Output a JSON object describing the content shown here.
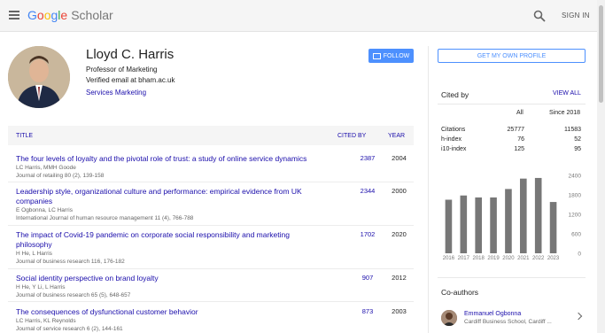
{
  "header": {
    "logo_google": [
      "G",
      "o",
      "o",
      "g",
      "l",
      "e"
    ],
    "logo_scholar": "Scholar",
    "signin": "SIGN IN"
  },
  "profile": {
    "name": "Lloyd C. Harris",
    "affiliation": "Professor of Marketing",
    "email": "Verified email at bham.ac.uk",
    "interest": "Services Marketing",
    "follow": "FOLLOW"
  },
  "table": {
    "col_title": "TITLE",
    "col_cited": "CITED BY",
    "col_year": "YEAR",
    "rows": [
      {
        "title": "The four levels of loyalty and the pivotal role of trust: a study of online service dynamics",
        "authors": "LC Harris, MMH Goode",
        "journal": "Journal of retailing 80 (2), 139-158",
        "cited": "2387",
        "year": "2004"
      },
      {
        "title": "Leadership style, organizational culture and performance: empirical evidence from UK companies",
        "authors": "E Ogbonna, LC Harris",
        "journal": "International Journal of human resource management 11 (4), 766-788",
        "cited": "2344",
        "year": "2000"
      },
      {
        "title": "The impact of Covid-19 pandemic on corporate social responsibility and marketing philosophy",
        "authors": "H He, L Harris",
        "journal": "Journal of business research 116, 176-182",
        "cited": "1702",
        "year": "2020"
      },
      {
        "title": "Social identity perspective on brand loyalty",
        "authors": "H He, Y Li, L Harris",
        "journal": "Journal of business research 65 (5), 648-657",
        "cited": "907",
        "year": "2012"
      },
      {
        "title": "The consequences of dysfunctional customer behavior",
        "authors": "LC Harris, KL Reynolds",
        "journal": "Journal of service research 6 (2), 144-161",
        "cited": "873",
        "year": "2003"
      }
    ]
  },
  "sidebar": {
    "get_profile": "GET MY OWN PROFILE",
    "cited_by": "Cited by",
    "view_all": "VIEW ALL",
    "stats_col_all": "All",
    "stats_col_since": "Since 2018",
    "stats": [
      {
        "label": "Citations",
        "all": "25777",
        "since": "11583"
      },
      {
        "label": "h-index",
        "all": "76",
        "since": "52"
      },
      {
        "label": "i10-index",
        "all": "125",
        "since": "95"
      }
    ],
    "coauthors_title": "Co-authors",
    "coauthor": {
      "name": "Emmanuel Ogbonna",
      "affiliation": "Cardiff Business School, Cardiff ..."
    }
  },
  "chart_data": {
    "type": "bar",
    "categories": [
      "2016",
      "2017",
      "2018",
      "2019",
      "2020",
      "2021",
      "2022",
      "2023"
    ],
    "values": [
      1650,
      1780,
      1720,
      1720,
      1980,
      2300,
      2320,
      1580
    ],
    "ylim": [
      0,
      2400
    ],
    "yticks": [
      "0",
      "600",
      "1200",
      "1800",
      "2400"
    ],
    "bar_color": "#777777"
  },
  "colors": {
    "link": "#1a0dab",
    "accent": "#4d90fe"
  }
}
